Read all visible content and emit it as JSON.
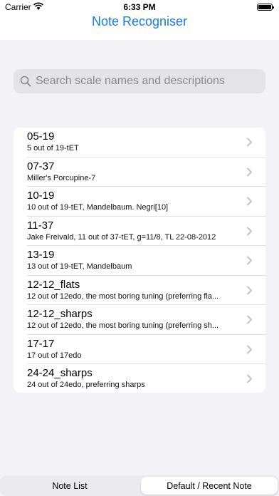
{
  "status_bar": {
    "carrier": "Carrier",
    "time": "6:33 PM"
  },
  "nav": {
    "title": "Note Recogniser"
  },
  "search": {
    "placeholder": "Search scale names and descriptions"
  },
  "scales": [
    {
      "title": "05-19",
      "subtitle": "5 out of 19-tET"
    },
    {
      "title": "07-37",
      "subtitle": "Miller's Porcupine-7"
    },
    {
      "title": "10-19",
      "subtitle": "10 out of 19-tET, Mandelbaum. Negri[10]"
    },
    {
      "title": "11-37",
      "subtitle": "Jake Freivald, 11 out of 37-tET, g=11/8, TL 22-08-2012"
    },
    {
      "title": "13-19",
      "subtitle": "13 out of 19-tET, Mandelbaum"
    },
    {
      "title": "12-12_flats",
      "subtitle": "12 out of 12edo, the most boring tuning (preferring fla..."
    },
    {
      "title": "12-12_sharps",
      "subtitle": "12 out of 12edo, the most boring tuning (preferring sh..."
    },
    {
      "title": "17-17",
      "subtitle": "17 out of 17edo"
    },
    {
      "title": "24-24_sharps",
      "subtitle": "24 out of 24edo, preferring sharps"
    }
  ],
  "tabs": {
    "note_list": "Note List",
    "default_recent": "Default / Recent Note"
  },
  "colors": {
    "accent": "#1a7ae8",
    "background": "#f2f2f7"
  }
}
